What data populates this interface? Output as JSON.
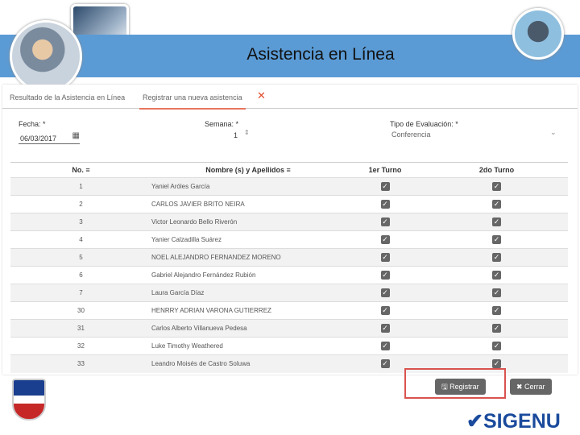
{
  "header": {
    "title": "Asistencia en Línea"
  },
  "tabs": [
    {
      "label": "Resultado de la Asistencia en Línea"
    },
    {
      "label": "Registrar una nueva asistencia"
    }
  ],
  "form": {
    "fecha_label": "Fecha: *",
    "fecha_value": "06/03/2017",
    "semana_label": "Semana: *",
    "semana_value": "1",
    "tipo_label": "Tipo de Evaluación: *",
    "tipo_value": "Conferencia"
  },
  "table": {
    "headers": [
      "No.",
      "Nombre (s) y Apellidos",
      "1er Turno",
      "2do Turno"
    ],
    "rows": [
      {
        "no": "1",
        "name": "Yaniel Aróles García"
      },
      {
        "no": "2",
        "name": "CARLOS JAVIER BRITO NEIRA"
      },
      {
        "no": "3",
        "name": "Victor Leonardo Bello Riverón"
      },
      {
        "no": "4",
        "name": "Yanier Calzadilla Suárez"
      },
      {
        "no": "5",
        "name": "NOEL ALEJANDRO FERNANDEZ MORENO"
      },
      {
        "no": "6",
        "name": "Gabriel Alejandro Fernández Rubión"
      },
      {
        "no": "7",
        "name": "Laura García Díaz"
      },
      {
        "no": "30",
        "name": "HENRRY ADRIAN VARONA GUTIERREZ"
      },
      {
        "no": "31",
        "name": "Carlos Alberto Villanueva Pedesa"
      },
      {
        "no": "32",
        "name": "Luke Timothy Weathered"
      },
      {
        "no": "33",
        "name": "Leandro Moisés de Castro Soluwa"
      }
    ]
  },
  "buttons": {
    "register": "Registrar",
    "close": "Cerrar"
  },
  "brand": {
    "logo": "SIGENU"
  }
}
